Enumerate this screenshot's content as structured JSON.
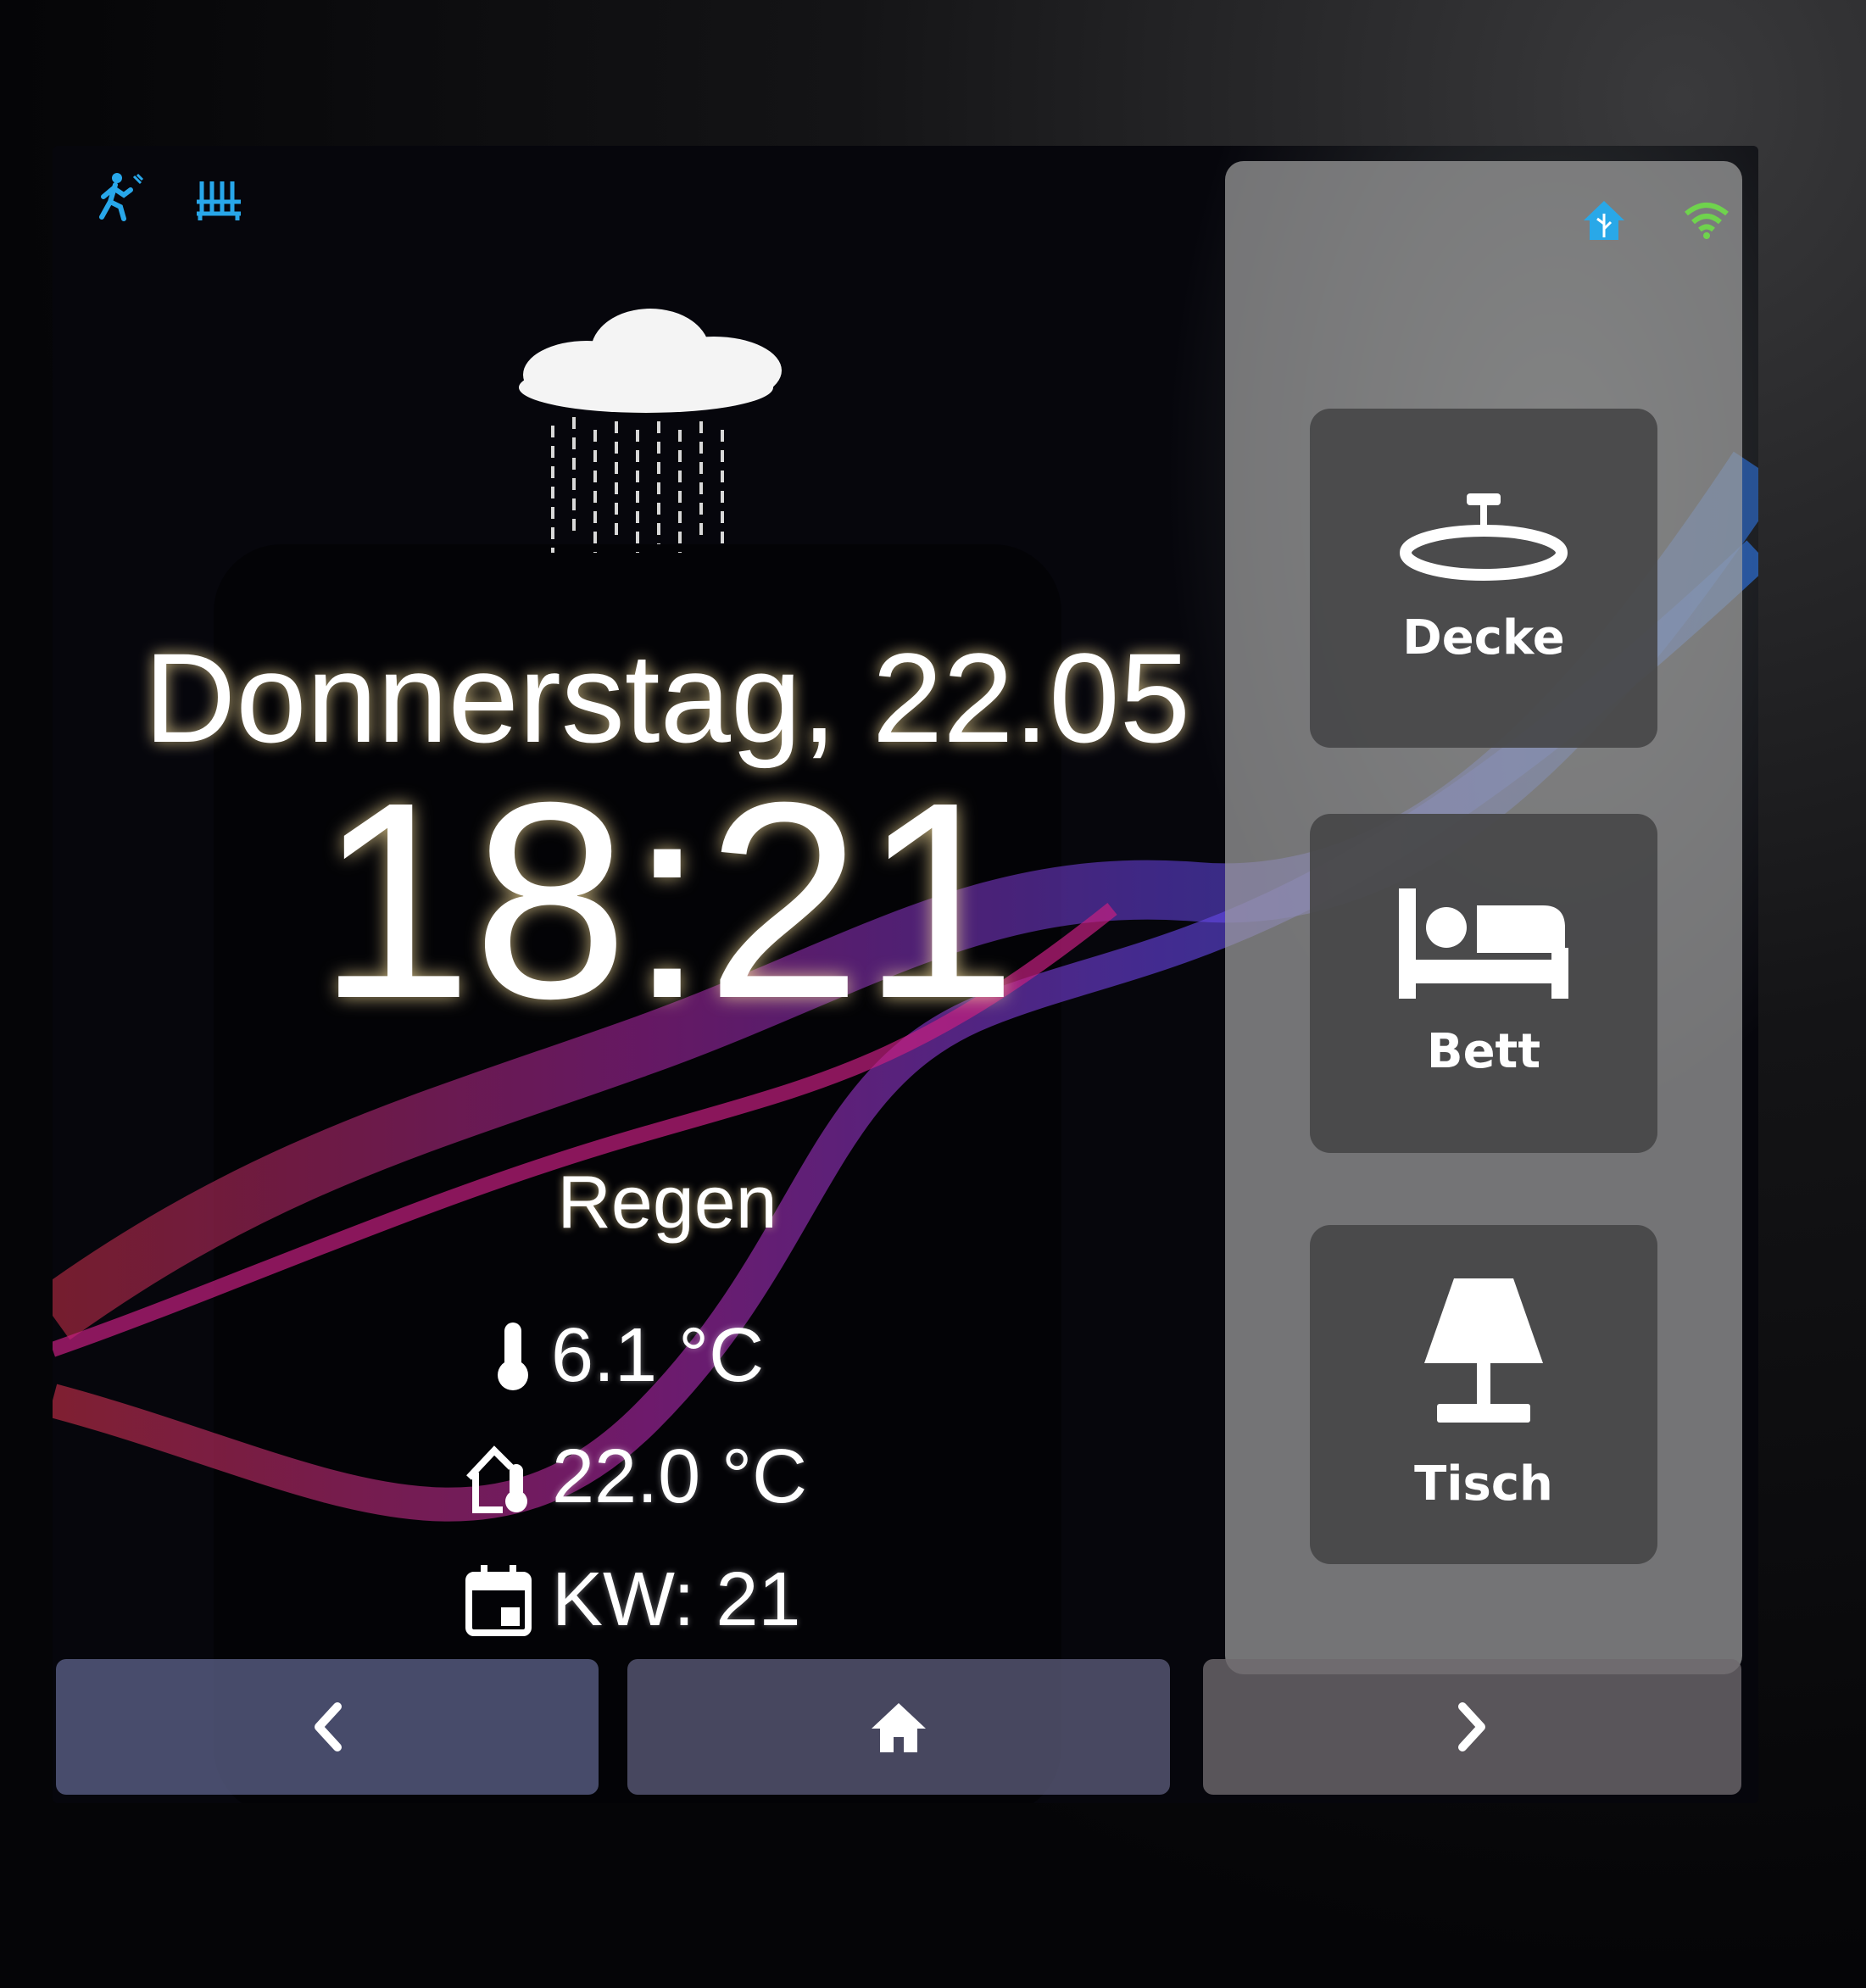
{
  "status_bar": {
    "left_icons": [
      "motion-sensor-icon",
      "radiator-icon"
    ],
    "right_icons": [
      "home-assistant-icon",
      "wifi-icon"
    ],
    "colors": {
      "left": "#28a7ea",
      "home": "#29a8e8",
      "wifi": "#6fd34d"
    }
  },
  "weather": {
    "icon": "cloud-rain-icon",
    "date": "Donnerstag, 22.05",
    "time": "18:21",
    "condition": "Regen",
    "outdoor_temp": "6.1 °C",
    "indoor_temp": "22.0 °C",
    "week": "KW: 21"
  },
  "tiles": [
    {
      "label": "Decke",
      "icon": "ceiling-light-icon"
    },
    {
      "label": "Bett",
      "icon": "bed-icon"
    },
    {
      "label": "Tisch",
      "icon": "table-lamp-icon"
    }
  ],
  "nav": {
    "prev_icon": "chevron-left-icon",
    "home_icon": "home-icon",
    "next_icon": "chevron-right-icon"
  }
}
